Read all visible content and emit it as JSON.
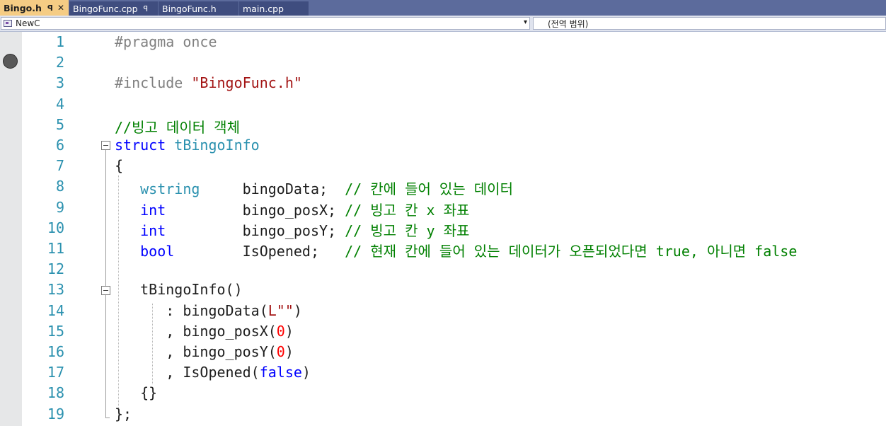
{
  "tabs": [
    {
      "label": "Bingo.h",
      "active": true,
      "pin": "ꟼ",
      "close": "✕"
    },
    {
      "label": "BingoFunc.cpp",
      "active": false,
      "pin": "ꟼ"
    },
    {
      "label": "BingoFunc.h",
      "active": false
    },
    {
      "label": "main.cpp",
      "active": false
    }
  ],
  "navbar": {
    "class_icon": "class-icon",
    "class_label": "NewC",
    "dropdown_icon": "▾",
    "scope_label": "(전역 범위)"
  },
  "colors": {
    "keyword": "#0000ff",
    "type": "#2b91af",
    "string": "#a31515",
    "comment": "#008000",
    "preprocessor": "#808080",
    "text": "#1e1e1e",
    "number": "#ff0000",
    "line_number": "#2b91af"
  },
  "editor": {
    "breakpoint_line": 2,
    "lines": [
      {
        "num": "1",
        "tokens": [
          [
            "#pragma once",
            "preprocessor"
          ]
        ]
      },
      {
        "num": "2",
        "tokens": []
      },
      {
        "num": "3",
        "tokens": [
          [
            "#include ",
            "preprocessor"
          ],
          [
            "\"BingoFunc.h\"",
            "string"
          ]
        ]
      },
      {
        "num": "4",
        "tokens": []
      },
      {
        "num": "5",
        "tokens": [
          [
            "//빙고 데이터 객체",
            "comment"
          ]
        ]
      },
      {
        "num": "6",
        "tokens": [
          [
            "struct",
            "keyword"
          ],
          [
            " ",
            "text"
          ],
          [
            "tBingoInfo",
            "type"
          ]
        ]
      },
      {
        "num": "7",
        "tokens": [
          [
            "{",
            "text"
          ]
        ]
      },
      {
        "num": "8",
        "tokens": [
          [
            "   ",
            "text"
          ],
          [
            "wstring",
            "type"
          ],
          [
            "     bingoData;  ",
            "text"
          ],
          [
            "// 칸에 들어 있는 데이터",
            "comment"
          ]
        ]
      },
      {
        "num": "9",
        "tokens": [
          [
            "   ",
            "text"
          ],
          [
            "int",
            "keyword"
          ],
          [
            "         bingo_posX; ",
            "text"
          ],
          [
            "// 빙고 칸 x 좌표",
            "comment"
          ]
        ]
      },
      {
        "num": "10",
        "tokens": [
          [
            "   ",
            "text"
          ],
          [
            "int",
            "keyword"
          ],
          [
            "         bingo_posY; ",
            "text"
          ],
          [
            "// 빙고 칸 y 좌표",
            "comment"
          ]
        ]
      },
      {
        "num": "11",
        "tokens": [
          [
            "   ",
            "text"
          ],
          [
            "bool",
            "keyword"
          ],
          [
            "        IsOpened;   ",
            "text"
          ],
          [
            "// 현재 칸에 들어 있는 데이터가 오픈되었다면 true, 아니면 false",
            "comment"
          ]
        ]
      },
      {
        "num": "12",
        "tokens": []
      },
      {
        "num": "13",
        "tokens": [
          [
            "   tBingoInfo()",
            "text"
          ]
        ]
      },
      {
        "num": "14",
        "tokens": [
          [
            "      : bingoData(",
            "text"
          ],
          [
            "L\"\"",
            "string"
          ],
          [
            ")",
            "text"
          ]
        ]
      },
      {
        "num": "15",
        "tokens": [
          [
            "      , bingo_posX(",
            "text"
          ],
          [
            "0",
            "number"
          ],
          [
            ")",
            "text"
          ]
        ]
      },
      {
        "num": "16",
        "tokens": [
          [
            "      , bingo_posY(",
            "text"
          ],
          [
            "0",
            "number"
          ],
          [
            ")",
            "text"
          ]
        ]
      },
      {
        "num": "17",
        "tokens": [
          [
            "      , IsOpened(",
            "text"
          ],
          [
            "false",
            "keyword"
          ],
          [
            ")",
            "text"
          ]
        ]
      },
      {
        "num": "18",
        "tokens": [
          [
            "   {}",
            "text"
          ]
        ]
      },
      {
        "num": "19",
        "tokens": [
          [
            "};",
            "text"
          ]
        ]
      }
    ]
  }
}
